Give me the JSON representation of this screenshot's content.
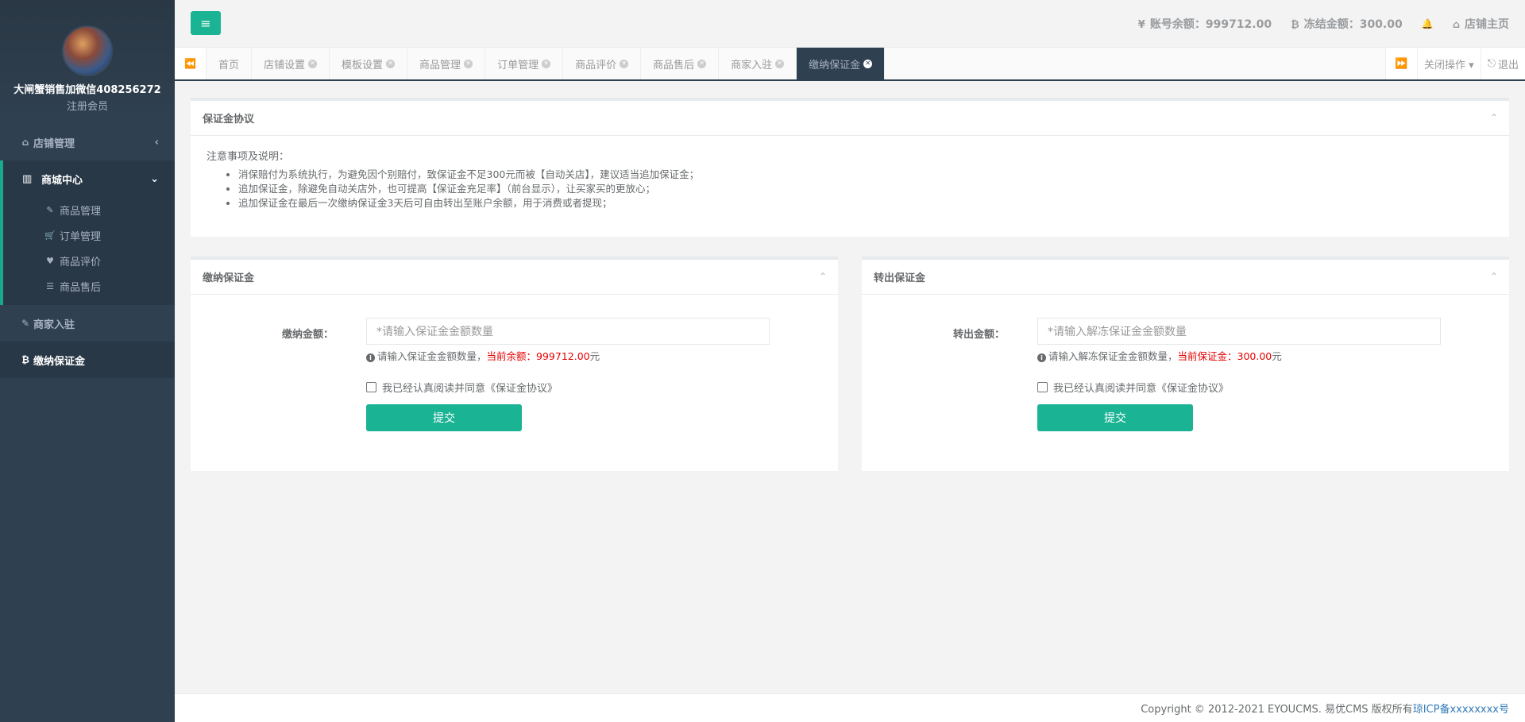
{
  "sidebar": {
    "profile": {
      "name": "大闸蟹销售加微信408256272",
      "role": "注册会员"
    },
    "items": [
      {
        "label": "店铺管理",
        "icon": "home-icon",
        "glyph": "⌂",
        "arrow": "‹"
      },
      {
        "label": "商家入驻",
        "icon": "edit-icon",
        "glyph": "✎"
      },
      {
        "label": "缴纳保证金",
        "icon": "bitcoin-icon",
        "glyph": "₿"
      }
    ],
    "group": {
      "label": "商城中心",
      "icon": "bar-chart-icon",
      "glyph": "▥",
      "arrow": "⌄",
      "sub_items": [
        {
          "label": "商品管理",
          "icon": "edit-square-icon",
          "glyph": "✎"
        },
        {
          "label": "订单管理",
          "icon": "cart-icon",
          "glyph": "🛒"
        },
        {
          "label": "商品评价",
          "icon": "heart-icon",
          "glyph": "♥"
        },
        {
          "label": "商品售后",
          "icon": "database-icon",
          "glyph": "☰"
        }
      ]
    }
  },
  "topbar": {
    "menu_glyph": "≡",
    "balance": {
      "icon": "yen-icon",
      "glyph": "¥",
      "label": "账号余额：999712.00"
    },
    "frozen": {
      "icon": "bitcoin-icon",
      "glyph": "₿",
      "label": "冻结金额：300.00"
    },
    "bell_glyph": "🔔",
    "home": {
      "icon": "home-icon",
      "glyph": "⌂",
      "label": "店铺主页"
    }
  },
  "tabs": {
    "prev_glyph": "⏪",
    "next_glyph": "⏩",
    "items": [
      {
        "label": "首页",
        "closable": false
      },
      {
        "label": "店铺设置",
        "closable": true
      },
      {
        "label": "模板设置",
        "closable": true
      },
      {
        "label": "商品管理",
        "closable": true
      },
      {
        "label": "订单管理",
        "closable": true
      },
      {
        "label": "商品评价",
        "closable": true
      },
      {
        "label": "商品售后",
        "closable": true
      },
      {
        "label": "商家入驻",
        "closable": true
      },
      {
        "label": "缴纳保证金",
        "closable": true,
        "active": true
      }
    ],
    "close_ops": "关闭操作 ▾",
    "logout": "退出",
    "logout_glyph": "⎋"
  },
  "agreement": {
    "title": "保证金协议",
    "collapse_glyph": "⌃",
    "notes_head": "注意事项及说明：",
    "notes": [
      "消保赔付为系统执行，为避免因个别赔付，致保证金不足300元而被【自动关店】，建议适当追加保证金；",
      "追加保证金，除避免自动关店外，也可提高【保证金充足率】（前台显示），让买家买的更放心；",
      "追加保证金在最后一次缴纳保证金3天后可自由转出至账户余额，用于消费或者提现；"
    ]
  },
  "pay": {
    "title": "缴纳保证金",
    "label": "缴纳金额：",
    "placeholder": "*请输入保证金金额数量",
    "help_prefix": "请输入保证金金额数量，",
    "help_red": "当前余额：999712.00",
    "help_suffix": "元",
    "agree": "我已经认真阅读并同意《保证金协议》",
    "submit": "提交"
  },
  "withdraw": {
    "title": "转出保证金",
    "label": "转出金额：",
    "placeholder": "*请输入解冻保证金金额数量",
    "help_prefix": "请输入解冻保证金金额数量，",
    "help_red": "当前保证金：300.00",
    "help_suffix": "元",
    "agree": "我已经认真阅读并同意《保证金协议》",
    "submit": "提交"
  },
  "footer": {
    "copyright": "Copyright © 2012-2021 EYOUCMS. 易优CMS 版权所有",
    "icp": "琼ICP备xxxxxxxx号"
  },
  "colors": {
    "accent": "#1ab394",
    "sidebar": "#2f4050",
    "red": "#e60000"
  }
}
